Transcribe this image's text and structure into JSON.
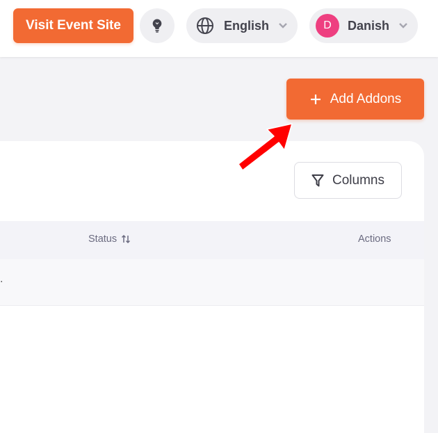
{
  "header": {
    "visit_site_label": "Visit Event Site",
    "language": {
      "label": "English"
    },
    "user": {
      "avatar_initial": "D",
      "name": "Danish"
    }
  },
  "toolbar": {
    "add_addons_label": "Add Addons"
  },
  "table": {
    "columns_button_label": "Columns",
    "headers": {
      "status": "Status",
      "actions": "Actions"
    },
    "rows": [
      {
        "fragment": "."
      }
    ]
  },
  "icons": {
    "bulb": "lightbulb-icon",
    "globe": "globe-icon",
    "chevron": "chevron-down-icon",
    "plus": "plus-icon",
    "funnel": "filter-icon",
    "sort": "sort-icon",
    "arrow": "pointer-arrow-icon"
  },
  "colors": {
    "accent": "#f26a33",
    "avatar": "#ee3f80",
    "annotation_arrow": "#ff0000"
  }
}
